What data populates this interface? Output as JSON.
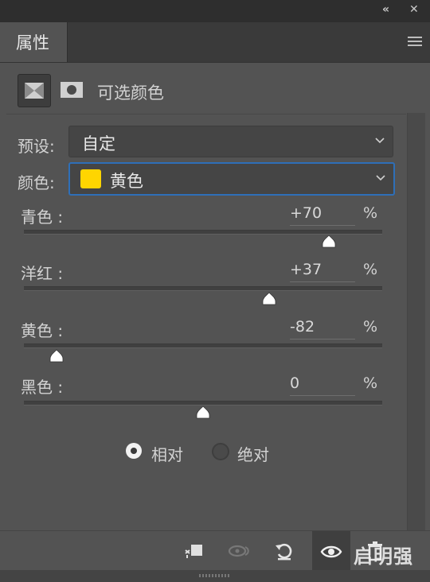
{
  "window": {
    "collapse_glyph": "«",
    "close_glyph": "✕"
  },
  "tab": {
    "label": "属性"
  },
  "header": {
    "title": "可选颜色"
  },
  "preset": {
    "label": "预设:",
    "value": "自定"
  },
  "color": {
    "label": "颜色:",
    "value": "黄色",
    "swatch_color": "#ffd500"
  },
  "sliders": [
    {
      "label": "青色 :",
      "value": "+70",
      "unit": "%",
      "percent": 70
    },
    {
      "label": "洋红 :",
      "value": "+37",
      "unit": "%",
      "percent": 37
    },
    {
      "label": "黄色 :",
      "value": "-82",
      "unit": "%",
      "percent": -82
    },
    {
      "label": "黑色 :",
      "value": "0",
      "unit": "%",
      "percent": 0
    }
  ],
  "method": {
    "relative_label": "相对",
    "absolute_label": "绝对",
    "selected": "relative"
  },
  "watermark": "启明强",
  "colors": {
    "panel": "#535353",
    "accent": "#2e6fb8"
  }
}
